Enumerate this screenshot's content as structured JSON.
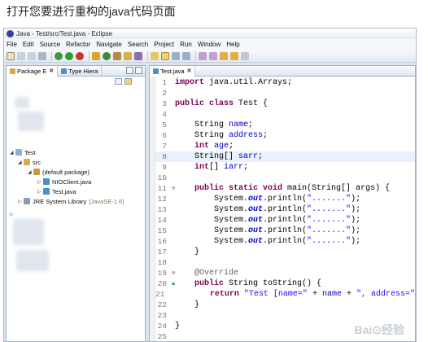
{
  "caption": "打开您要进行重构的java代码页面",
  "window": {
    "title": "Java - Test/src/Test.java - Eclipse"
  },
  "menu": [
    "File",
    "Edit",
    "Source",
    "Refactor",
    "Navigate",
    "Search",
    "Project",
    "Run",
    "Window",
    "Help"
  ],
  "left_tabs": [
    {
      "label": "Package E",
      "close": "✖"
    },
    {
      "label": "Type Hiera"
    }
  ],
  "tree": [
    {
      "label": "Test"
    },
    {
      "label": "src"
    },
    {
      "label": "(default package)"
    },
    {
      "label": "NIOClient.java"
    },
    {
      "label": "Test.java"
    },
    {
      "label": "JRE System Library",
      "suffix": "[JavaSE-1.6]"
    }
  ],
  "editor": {
    "tab_label": "Test.java",
    "tab_close": "✖",
    "highlighted_line": 8,
    "lines": [
      {
        "n": "1",
        "tokens": [
          {
            "k": "kw",
            "t": "import"
          },
          {
            "t": " java.util.Arrays;"
          }
        ]
      },
      {
        "n": "2",
        "tokens": []
      },
      {
        "n": "3",
        "tokens": [
          {
            "k": "kw",
            "t": "public class"
          },
          {
            "t": " Test {"
          }
        ]
      },
      {
        "n": "4",
        "tokens": []
      },
      {
        "n": "5",
        "tokens": [
          {
            "t": "    String "
          },
          {
            "k": "fld",
            "t": "name"
          },
          {
            "t": ";"
          }
        ]
      },
      {
        "n": "6",
        "tokens": [
          {
            "t": "    String "
          },
          {
            "k": "fld",
            "t": "address"
          },
          {
            "t": ";"
          }
        ]
      },
      {
        "n": "7",
        "tokens": [
          {
            "t": "    "
          },
          {
            "k": "kw",
            "t": "int"
          },
          {
            "t": " "
          },
          {
            "k": "fld",
            "t": "age"
          },
          {
            "t": ";"
          }
        ]
      },
      {
        "n": "8",
        "tokens": [
          {
            "t": "    String[] "
          },
          {
            "k": "fld",
            "t": "sarr"
          },
          {
            "t": ";"
          }
        ]
      },
      {
        "n": "9",
        "tokens": [
          {
            "t": "    "
          },
          {
            "k": "kw",
            "t": "int"
          },
          {
            "t": "[] "
          },
          {
            "k": "fld",
            "t": "iarr"
          },
          {
            "t": ";"
          }
        ]
      },
      {
        "n": "10",
        "tokens": []
      },
      {
        "n": "11",
        "fold": "⊖",
        "tokens": [
          {
            "t": "    "
          },
          {
            "k": "kw",
            "t": "public static void"
          },
          {
            "t": " main(String[] args) {"
          }
        ]
      },
      {
        "n": "12",
        "tokens": [
          {
            "t": "        System."
          },
          {
            "k": "st",
            "t": "out"
          },
          {
            "t": ".println("
          },
          {
            "k": "str",
            "t": "\".......\""
          },
          {
            "t": ");"
          }
        ]
      },
      {
        "n": "13",
        "tokens": [
          {
            "t": "        System."
          },
          {
            "k": "st",
            "t": "out"
          },
          {
            "t": ".println("
          },
          {
            "k": "str",
            "t": "\".......\""
          },
          {
            "t": ");"
          }
        ]
      },
      {
        "n": "14",
        "tokens": [
          {
            "t": "        System."
          },
          {
            "k": "st",
            "t": "out"
          },
          {
            "t": ".println("
          },
          {
            "k": "str",
            "t": "\".......\""
          },
          {
            "t": ");"
          }
        ]
      },
      {
        "n": "15",
        "tokens": [
          {
            "t": "        System."
          },
          {
            "k": "st",
            "t": "out"
          },
          {
            "t": ".println("
          },
          {
            "k": "str",
            "t": "\".......\""
          },
          {
            "t": ");"
          }
        ]
      },
      {
        "n": "16",
        "tokens": [
          {
            "t": "        System."
          },
          {
            "k": "st",
            "t": "out"
          },
          {
            "t": ".println("
          },
          {
            "k": "str",
            "t": "\".......\""
          },
          {
            "t": ");"
          }
        ]
      },
      {
        "n": "17",
        "tokens": [
          {
            "t": "    }"
          }
        ]
      },
      {
        "n": "18",
        "tokens": []
      },
      {
        "n": "19",
        "fold": "⊖",
        "tokens": [
          {
            "t": "    "
          },
          {
            "k": "ann",
            "t": "@Override"
          }
        ]
      },
      {
        "n": "20",
        "marker": "▲",
        "tokens": [
          {
            "t": "    "
          },
          {
            "k": "kw",
            "t": "public"
          },
          {
            "t": " String toString() {"
          }
        ]
      },
      {
        "n": "21",
        "tokens": [
          {
            "t": "        "
          },
          {
            "k": "kw",
            "t": "return"
          },
          {
            "t": " "
          },
          {
            "k": "str",
            "t": "\"Test [name=\""
          },
          {
            "t": " + "
          },
          {
            "k": "fld",
            "t": "name"
          },
          {
            "t": " + "
          },
          {
            "k": "str",
            "t": "\", address=\""
          }
        ]
      },
      {
        "n": "22",
        "tokens": [
          {
            "t": "    }"
          }
        ]
      },
      {
        "n": "23",
        "tokens": []
      },
      {
        "n": "24",
        "tokens": [
          {
            "t": "}"
          }
        ]
      },
      {
        "n": "25",
        "tokens": []
      }
    ]
  },
  "colors": {
    "keyword": "#7f0055",
    "field": "#0000c0",
    "string": "#2a00ff",
    "annotation": "#646464",
    "highlight_line": "#e8f2fe"
  }
}
